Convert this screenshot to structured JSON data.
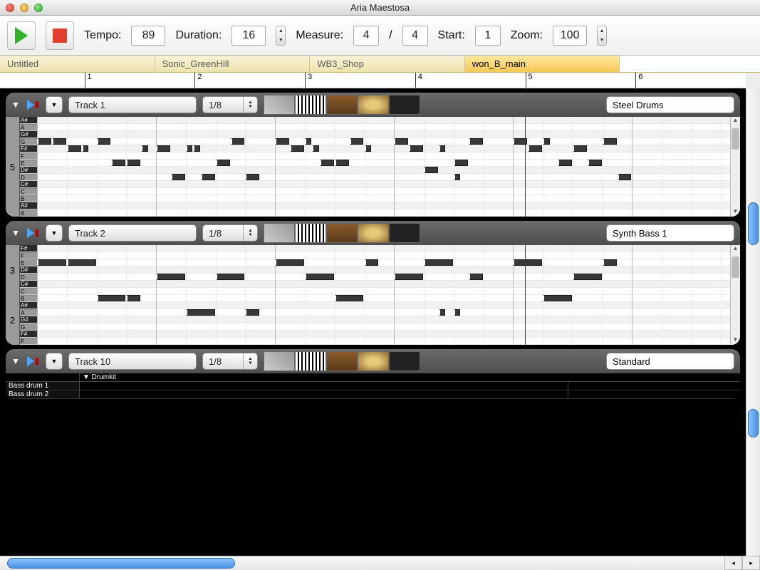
{
  "window": {
    "title": "Aria Maestosa"
  },
  "toolbar": {
    "tempo_label": "Tempo:",
    "tempo_value": "89",
    "duration_label": "Duration:",
    "duration_value": "16",
    "measure_label": "Measure:",
    "measure_num": "4",
    "measure_den": "4",
    "start_label": "Start:",
    "start_value": "1",
    "zoom_label": "Zoom:",
    "zoom_value": "100"
  },
  "tabs": [
    {
      "label": "Untitled",
      "active": false
    },
    {
      "label": "Sonic_GreenHill",
      "active": false
    },
    {
      "label": "WB3_Shop",
      "active": false
    },
    {
      "label": "won_B_main",
      "active": true
    }
  ],
  "ruler": {
    "numbers": [
      "1",
      "2",
      "3",
      "4",
      "5",
      "6"
    ]
  },
  "playhead_measure": 5.1,
  "tracks": [
    {
      "name": "Track 1",
      "note_value": "1/8",
      "instrument": "Steel Drums",
      "octave_label": "5",
      "key_rows": [
        "A#",
        "A",
        "G#",
        "G",
        "F#",
        "F",
        "E",
        "D#",
        "D",
        "C#",
        "C",
        "B",
        "A#",
        "A"
      ],
      "black_mask": [
        1,
        0,
        1,
        0,
        1,
        0,
        0,
        1,
        0,
        1,
        0,
        0,
        1,
        0
      ],
      "notes": [
        {
          "r": 3,
          "s": 0,
          "l": 2
        },
        {
          "r": 3,
          "s": 2,
          "l": 2
        },
        {
          "r": 4,
          "s": 4,
          "l": 2
        },
        {
          "r": 4,
          "s": 6,
          "l": 1
        },
        {
          "r": 3,
          "s": 8,
          "l": 2
        },
        {
          "r": 6,
          "s": 10,
          "l": 2
        },
        {
          "r": 6,
          "s": 12,
          "l": 2
        },
        {
          "r": 4,
          "s": 14,
          "l": 1
        },
        {
          "r": 4,
          "s": 16,
          "l": 2
        },
        {
          "r": 8,
          "s": 18,
          "l": 2
        },
        {
          "r": 4,
          "s": 20,
          "l": 1
        },
        {
          "r": 4,
          "s": 21,
          "l": 1
        },
        {
          "r": 8,
          "s": 22,
          "l": 2
        },
        {
          "r": 6,
          "s": 24,
          "l": 2
        },
        {
          "r": 3,
          "s": 26,
          "l": 2
        },
        {
          "r": 8,
          "s": 28,
          "l": 2
        },
        {
          "r": 3,
          "s": 32,
          "l": 2
        },
        {
          "r": 4,
          "s": 34,
          "l": 2
        },
        {
          "r": 3,
          "s": 36,
          "l": 1
        },
        {
          "r": 4,
          "s": 37,
          "l": 1
        },
        {
          "r": 6,
          "s": 38,
          "l": 2
        },
        {
          "r": 6,
          "s": 40,
          "l": 2
        },
        {
          "r": 3,
          "s": 42,
          "l": 2
        },
        {
          "r": 4,
          "s": 44,
          "l": 1
        },
        {
          "r": 3,
          "s": 48,
          "l": 2
        },
        {
          "r": 4,
          "s": 50,
          "l": 2
        },
        {
          "r": 7,
          "s": 52,
          "l": 2
        },
        {
          "r": 4,
          "s": 54,
          "l": 1
        },
        {
          "r": 6,
          "s": 56,
          "l": 2
        },
        {
          "r": 3,
          "s": 58,
          "l": 2
        },
        {
          "r": 8,
          "s": 56,
          "l": 1
        },
        {
          "r": 3,
          "s": 64,
          "l": 2
        },
        {
          "r": 4,
          "s": 66,
          "l": 2
        },
        {
          "r": 3,
          "s": 68,
          "l": 1
        },
        {
          "r": 6,
          "s": 70,
          "l": 2
        },
        {
          "r": 4,
          "s": 72,
          "l": 2
        },
        {
          "r": 6,
          "s": 74,
          "l": 2
        },
        {
          "r": 3,
          "s": 76,
          "l": 2
        },
        {
          "r": 8,
          "s": 78,
          "l": 2
        }
      ]
    },
    {
      "name": "Track 2",
      "note_value": "1/8",
      "instrument": "Synth Bass 1",
      "octave_labels": [
        "3",
        "2"
      ],
      "key_rows": [
        "F#",
        "F",
        "E",
        "D#",
        "D",
        "C#",
        "C",
        "B",
        "A#",
        "A",
        "G#",
        "G",
        "F#",
        "F"
      ],
      "black_mask": [
        1,
        0,
        0,
        1,
        0,
        1,
        0,
        0,
        1,
        0,
        1,
        0,
        1,
        0
      ],
      "notes": [
        {
          "r": 2,
          "s": 0,
          "l": 4
        },
        {
          "r": 2,
          "s": 4,
          "l": 4
        },
        {
          "r": 7,
          "s": 8,
          "l": 4
        },
        {
          "r": 7,
          "s": 12,
          "l": 2
        },
        {
          "r": 4,
          "s": 16,
          "l": 4
        },
        {
          "r": 9,
          "s": 20,
          "l": 4
        },
        {
          "r": 4,
          "s": 24,
          "l": 4
        },
        {
          "r": 9,
          "s": 28,
          "l": 2
        },
        {
          "r": 2,
          "s": 32,
          "l": 4
        },
        {
          "r": 4,
          "s": 36,
          "l": 4
        },
        {
          "r": 7,
          "s": 40,
          "l": 4
        },
        {
          "r": 2,
          "s": 44,
          "l": 2
        },
        {
          "r": 4,
          "s": 48,
          "l": 4
        },
        {
          "r": 2,
          "s": 52,
          "l": 4
        },
        {
          "r": 9,
          "s": 54,
          "l": 1
        },
        {
          "r": 9,
          "s": 56,
          "l": 1
        },
        {
          "r": 4,
          "s": 58,
          "l": 2
        },
        {
          "r": 2,
          "s": 64,
          "l": 4
        },
        {
          "r": 7,
          "s": 68,
          "l": 4
        },
        {
          "r": 4,
          "s": 72,
          "l": 4
        },
        {
          "r": 2,
          "s": 76,
          "l": 2
        }
      ]
    },
    {
      "name": "Track 10",
      "note_value": "1/8",
      "instrument": "Standard",
      "drum_header": "Drumkit",
      "drum_rows": [
        "Bass drum 1",
        "Bass drum 2"
      ]
    }
  ]
}
